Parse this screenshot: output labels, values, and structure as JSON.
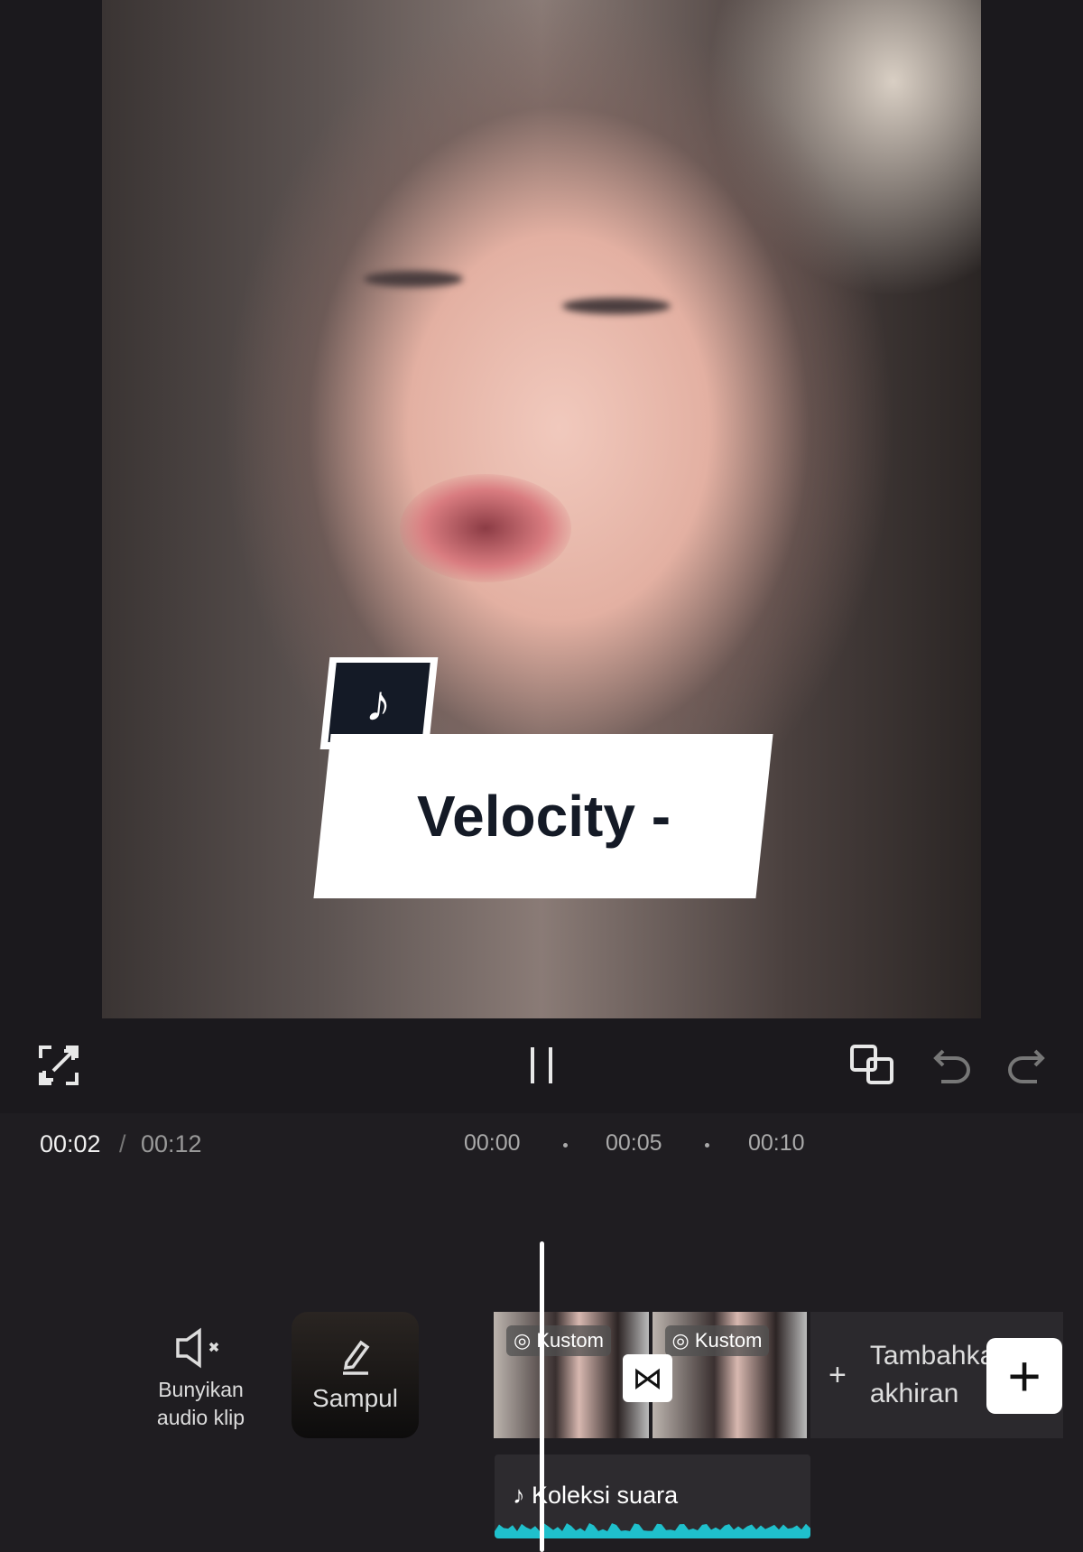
{
  "preview": {
    "sticker_icon": "tiktok-logo-icon",
    "sticker_text": "Velocity -"
  },
  "controls": {
    "fullscreen_icon": "fullscreen-icon",
    "pause_icon": "pause-icon",
    "keyframe_icon": "keyframe-icon",
    "undo_icon": "undo-icon",
    "redo_icon": "redo-icon"
  },
  "timeline": {
    "current": "00:02",
    "separator": "/",
    "total": "00:12",
    "ticks": [
      "00:00",
      "00:05",
      "00:10"
    ]
  },
  "tracks": {
    "mute_label": "Bunyikan audio klip",
    "cover_label": "Sampul",
    "clips": [
      {
        "badge": "Kustom"
      },
      {
        "badge": "Kustom"
      }
    ],
    "add_ending_label": "Tambahkan akhiran",
    "audio_label": "Koleksi suara",
    "waveform_color": "#1fc0cc"
  }
}
